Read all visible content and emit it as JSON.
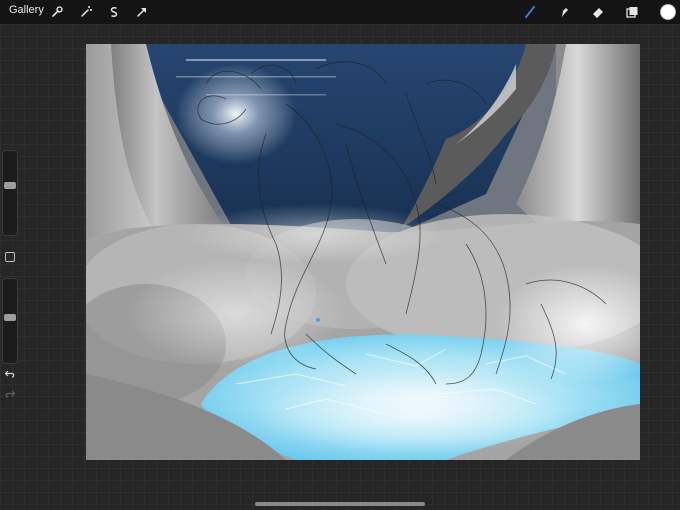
{
  "topbar": {
    "gallery_label": "Gallery",
    "left_tools": [
      {
        "name": "wrench-icon"
      },
      {
        "name": "magic-wand-icon"
      },
      {
        "name": "selection-icon"
      },
      {
        "name": "transform-arrow-icon"
      }
    ],
    "right_tools": [
      {
        "name": "brush-icon",
        "active": true
      },
      {
        "name": "smudge-icon"
      },
      {
        "name": "eraser-icon"
      },
      {
        "name": "layers-icon"
      }
    ],
    "active_color": "#ffffff",
    "active_tool_color": "#3d7bd9"
  },
  "sidebar": {
    "brush_size_level": 0.4,
    "opacity_level": 0.45,
    "modifier_icon": "square-modifier-icon",
    "undo_icon": "undo-icon",
    "redo_icon": "redo-icon"
  },
  "canvas": {
    "subject": "cave-pool-artwork",
    "colors": {
      "sky": "#1e3a5f",
      "rock": "#9a9a9a",
      "water": "#7fd6f2",
      "ground": "#8a8a8a"
    }
  }
}
